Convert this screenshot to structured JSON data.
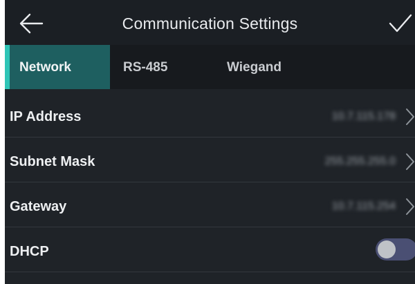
{
  "header": {
    "title": "Communication Settings",
    "back_icon": "arrow-left-icon",
    "confirm_icon": "checkmark-icon"
  },
  "tabs": [
    {
      "label": "Network",
      "active": true
    },
    {
      "label": "RS-485",
      "active": false
    },
    {
      "label": "Wiegand",
      "active": false
    }
  ],
  "settings": [
    {
      "label": "IP Address",
      "value": "10.7.115.178",
      "icon": "chevron-right-icon"
    },
    {
      "label": "Subnet Mask",
      "value": "255.255.255.0",
      "icon": "chevron-right-icon"
    },
    {
      "label": "Gateway",
      "value": "10.7.115.254",
      "icon": "chevron-right-icon"
    },
    {
      "label": "DHCP",
      "toggle_on": false
    }
  ],
  "colors": {
    "accent": "#2ec4b6",
    "active_tab_bg": "#1e5f60",
    "background": "#1f2328",
    "toggle_off_track": "#4a4f73"
  }
}
